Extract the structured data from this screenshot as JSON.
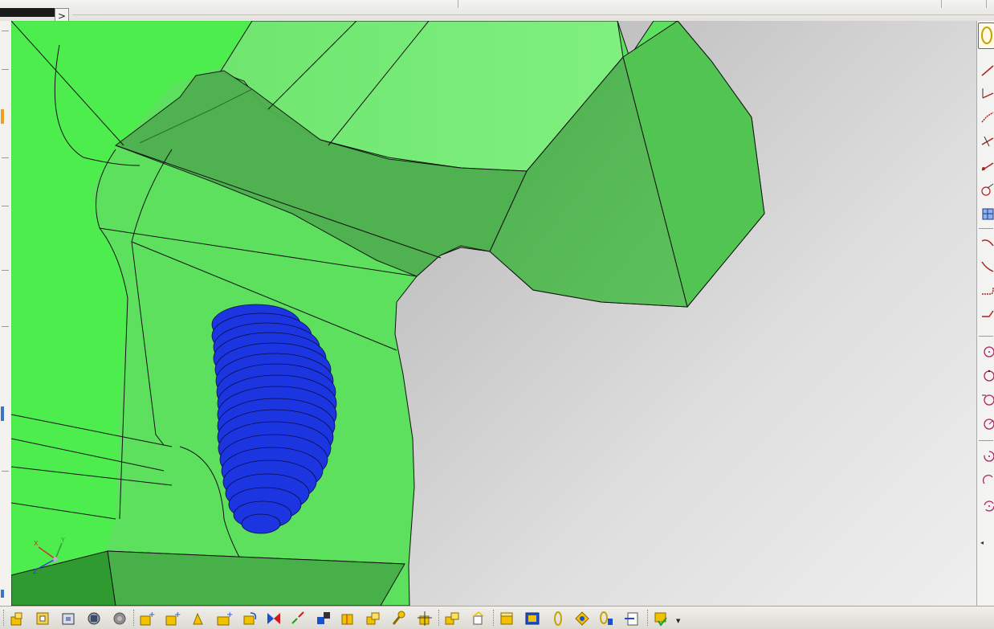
{
  "topbar": {
    "collapse_glyph": ">"
  },
  "viewport": {
    "part_color": "#3fef3f",
    "edge_color": "#111111",
    "thread_color": "#1428d8",
    "triad": {
      "x": "X",
      "y": "Y",
      "z": "Z"
    }
  },
  "right_toolbar": {
    "tools": [
      "select-icon",
      "line-icon",
      "axis-line-icon",
      "polyline-icon",
      "line-normal-icon",
      "line-angle-icon",
      "circle-arc-icon",
      "grid-icon",
      "spline-icon",
      "connect-curve-icon",
      "corner-icon",
      "chamfer-icon",
      "circle-icon",
      "three-point-circle-icon",
      "circle-tangent-icon",
      "circle-center-icon",
      "arc-icon",
      "arc-three-point-icon",
      "arc-limits-icon"
    ]
  },
  "bottom_toolbar": {
    "tools": [
      "new-part-icon",
      "open-icon",
      "component-icon",
      "product-icon",
      "gear-icon",
      "insert-icon",
      "insert-new-icon",
      "manipulate-icon",
      "insert-part-icon",
      "rotate-icon",
      "snap-icon",
      "explode-icon",
      "constraint-icon",
      "offset-icon",
      "measure-icon",
      "fix-icon",
      "axis-constraint-icon",
      "catalog-icon",
      "scene-icon",
      "box-icon",
      "section-icon",
      "link-icon",
      "constraint-star-icon",
      "analyze-icon",
      "check-icon",
      "update-icon"
    ]
  }
}
